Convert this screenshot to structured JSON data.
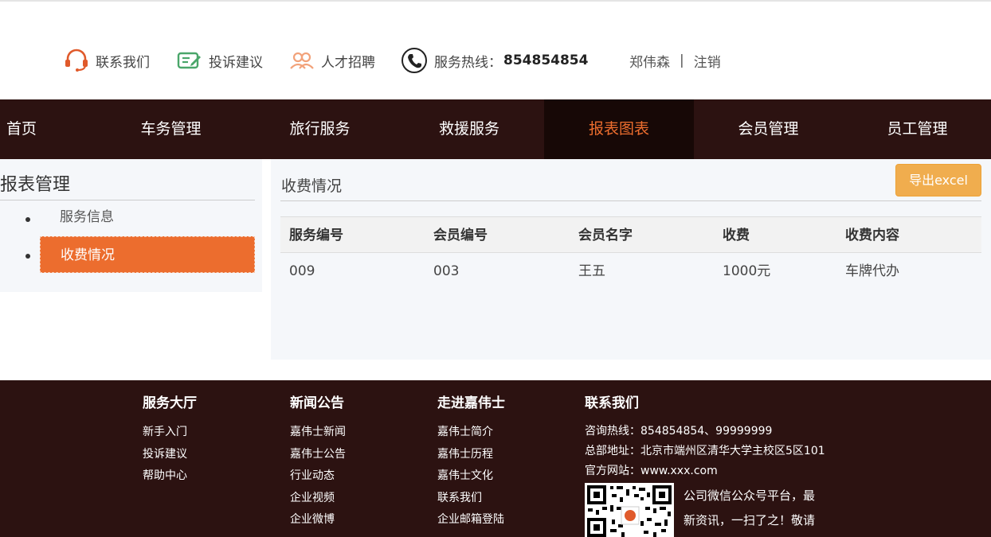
{
  "topbar": {
    "contact": "联系我们",
    "complaint": "投诉建议",
    "recruit": "人才招聘",
    "hotline_label": "服务热线：",
    "hotline_number": "854854854",
    "username": "郑伟森",
    "separator": "|",
    "logout": "注销"
  },
  "nav": [
    "首页",
    "车务管理",
    "旅行服务",
    "救援服务",
    "报表图表",
    "会员管理",
    "员工管理"
  ],
  "nav_active": "报表图表",
  "sidebar": {
    "title": "报表管理",
    "items": [
      "服务信息",
      "收费情况"
    ],
    "active": "收费情况"
  },
  "main": {
    "title": "收费情况",
    "export_label": "导出excel",
    "table": {
      "headers": [
        "服务编号",
        "会员编号",
        "会员名字",
        "收费",
        "收费内容"
      ],
      "rows": [
        [
          "009",
          "003",
          "王五",
          "1000元",
          "车牌代办"
        ]
      ]
    }
  },
  "footer": {
    "col1": {
      "title": "服务大厅",
      "links": [
        "新手入门",
        "投诉建议",
        "帮助中心"
      ]
    },
    "col2": {
      "title": "新闻公告",
      "links": [
        "嘉伟士新闻",
        "嘉伟士公告",
        "行业动态",
        "企业视频",
        "企业微博"
      ]
    },
    "col3": {
      "title": "走进嘉伟士",
      "links": [
        "嘉伟士简介",
        "嘉伟士历程",
        "嘉伟士文化",
        "联系我们",
        "企业邮箱登陆"
      ]
    },
    "col4": {
      "title": "联系我们",
      "phone": "咨询热线：854854854、99999999",
      "address": "总部地址：北京市端州区清华大学主校区5区101",
      "website": "官方网站：www.xxx.com",
      "qr_text_1": "公司微信公众号平台，最",
      "qr_text_2": "新资讯，一扫了之！敬请"
    }
  },
  "colors": {
    "nav_bg": "#2c1211",
    "accent": "#ec6d2e",
    "export": "#f0ad4e"
  }
}
